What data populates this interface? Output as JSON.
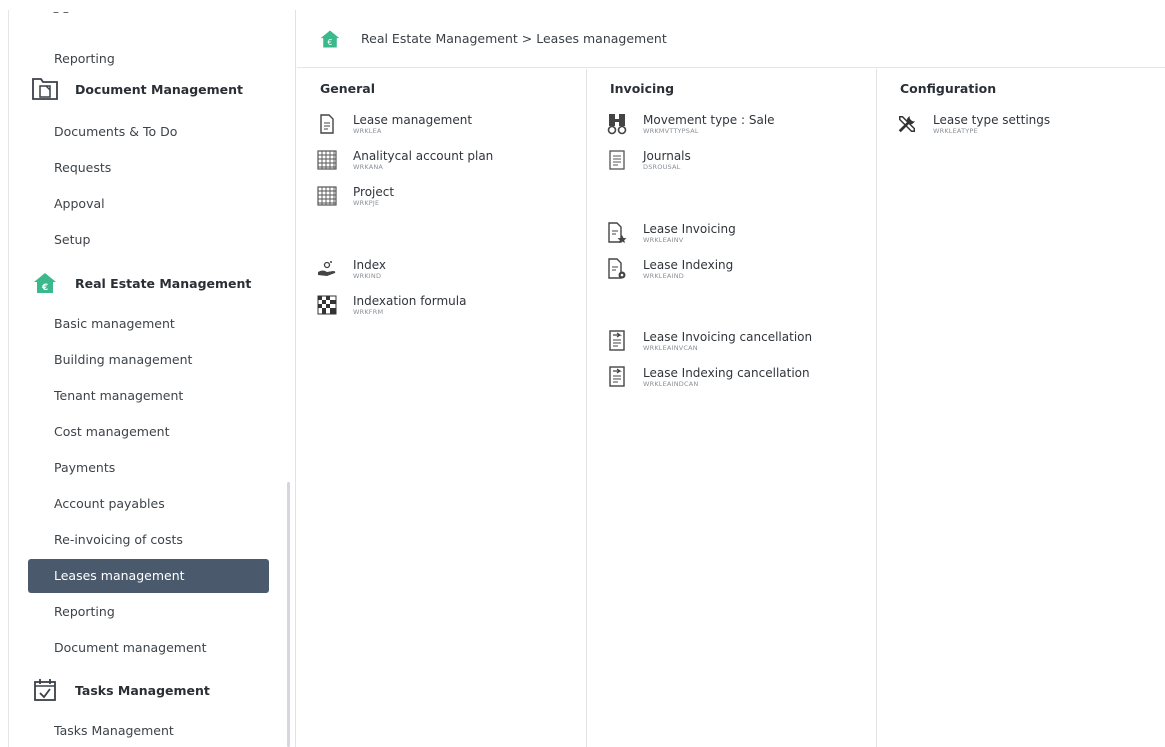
{
  "sidebar": {
    "top_reporting": "Reporting",
    "document_management": {
      "title": "Document Management",
      "items": [
        "Documents & To Do",
        "Requests",
        "Appoval",
        "Setup"
      ]
    },
    "real_estate": {
      "title": "Real Estate Management",
      "items": [
        "Basic management",
        "Building management",
        "Tenant management",
        "Cost management",
        "Payments",
        "Account payables",
        "Re-invoicing of costs",
        "Leases management",
        "Reporting",
        "Document management"
      ],
      "active_item": "Leases management"
    },
    "tasks": {
      "title": "Tasks Management",
      "items": [
        "Tasks Management"
      ]
    }
  },
  "breadcrumb": "Real Estate Management > Leases management",
  "columns": {
    "general": {
      "title": "General",
      "entries": [
        {
          "label": "Lease management",
          "code": "WRKLEA",
          "icon": "document-icon"
        },
        {
          "label": "Analitycal account plan",
          "code": "WRKANA",
          "icon": "grid-icon"
        },
        {
          "label": "Project",
          "code": "WRKPJE",
          "icon": "grid-icon"
        },
        {
          "label": "Index",
          "code": "WRKIND",
          "icon": "hand-coin-icon"
        },
        {
          "label": "Indexation formula",
          "code": "WRKFRM",
          "icon": "checker-icon"
        }
      ]
    },
    "invoicing": {
      "title": "Invoicing",
      "entries": [
        {
          "label": "Movement type : Sale",
          "code": "WRKMVTTYPSAL",
          "icon": "binoculars-icon"
        },
        {
          "label": "Journals",
          "code": "DSROUSAL",
          "icon": "journal-icon"
        },
        {
          "label": "Lease Invoicing",
          "code": "WRKLEAINV",
          "icon": "invoice-star-icon"
        },
        {
          "label": "Lease Indexing",
          "code": "WRKLEAIND",
          "icon": "invoice-gear-icon"
        },
        {
          "label": "Lease Invoicing cancellation",
          "code": "WRKLEAINVCAN",
          "icon": "cancel-doc-icon"
        },
        {
          "label": "Lease Indexing cancellation",
          "code": "WRKLEAINDCAN",
          "icon": "cancel-doc-icon"
        }
      ]
    },
    "configuration": {
      "title": "Configuration",
      "entries": [
        {
          "label": "Lease type settings",
          "code": "WRKLEATYPE",
          "icon": "tools-icon"
        }
      ]
    }
  },
  "colors": {
    "active_bg": "#4a5a6c",
    "house_green": "#3bb98d"
  }
}
